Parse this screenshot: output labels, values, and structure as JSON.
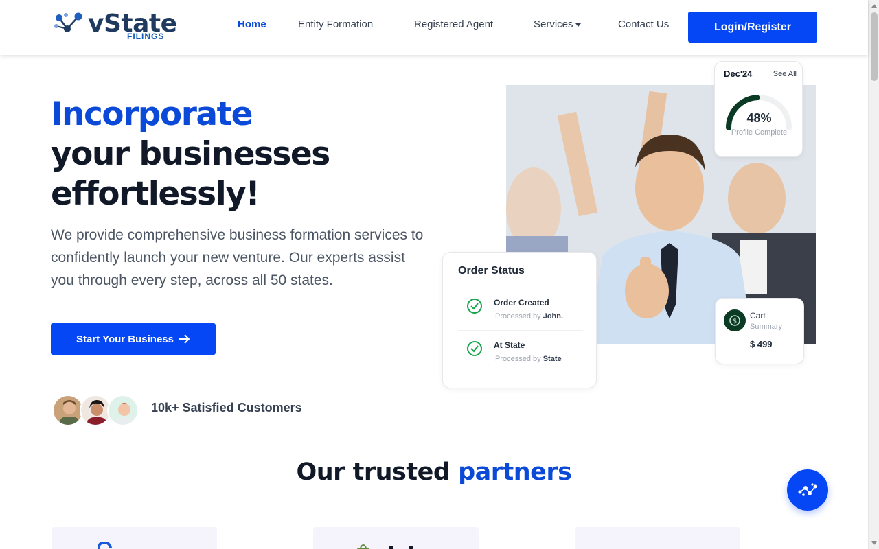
{
  "brand": {
    "name": "vState",
    "tagline": "FILINGS"
  },
  "nav": {
    "home": "Home",
    "entity_formation": "Entity Formation",
    "registered_agent": "Registered Agent",
    "services": "Services",
    "contact": "Contact Us",
    "login": "Login/Register"
  },
  "hero": {
    "title_line1": "Incorporate",
    "title_line2": "your businesses",
    "title_line3": "effortlessly!",
    "description": "We provide comprehensive business formation services to confidently launch your new venture. Our experts assist you through every step, across all 50 states.",
    "cta": "Start Your Business",
    "cta_icon": "arrow-right-icon",
    "customers": "10k+ Satisfied Customers"
  },
  "progress_card": {
    "month": "Dec'24",
    "see_all": "See All",
    "percent": "48%",
    "percent_value": 0.48,
    "label": "Profile Complete"
  },
  "order_status": {
    "title": "Order Status",
    "items": [
      {
        "name": "Order Created",
        "sub_prefix": "Processed by",
        "sub_value": "John."
      },
      {
        "name": "At State",
        "sub_prefix": "Processed by",
        "sub_value": "State"
      }
    ]
  },
  "cart": {
    "title": "Cart",
    "subtitle": "Summary",
    "price": "$ 499"
  },
  "partners": {
    "title_dark": "Our trusted",
    "title_blue": "partners"
  },
  "colors": {
    "accent": "#0546f5",
    "brand_blue": "#0b4ad8",
    "gauge": "#0b3b24"
  }
}
